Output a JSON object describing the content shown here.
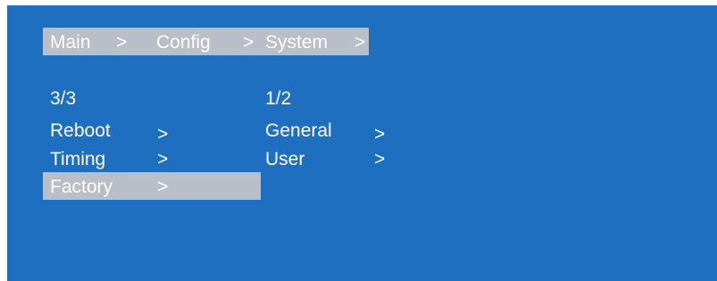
{
  "breadcrumb": {
    "main": "Main",
    "sep1": ">",
    "config": "Config",
    "sep2": ">",
    "system": "System",
    "sep3": ">"
  },
  "left_menu": {
    "page": "3/3",
    "items": [
      {
        "label": "Reboot",
        "arrow": ">"
      },
      {
        "label": "Timing",
        "arrow": ">"
      },
      {
        "label": "Factory",
        "arrow": ">"
      }
    ],
    "selected_index": 2
  },
  "right_menu": {
    "page": "1/2",
    "items": [
      {
        "label": "General",
        "arrow": ">"
      },
      {
        "label": "User",
        "arrow": ">"
      }
    ]
  },
  "colors": {
    "background": "#1f6fc0",
    "highlight": "#b9bfc8",
    "text": "#ffffff"
  }
}
